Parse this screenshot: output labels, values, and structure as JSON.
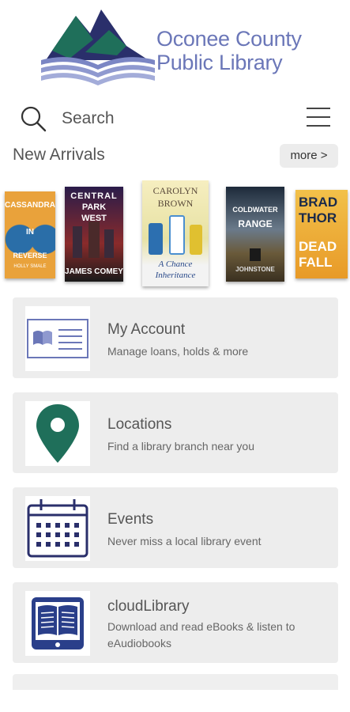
{
  "app": {
    "title": "Oconee County Public Library"
  },
  "header": {
    "logo_line1": "Oconee County",
    "logo_line2": "Public Library"
  },
  "search": {
    "label": "Search",
    "icon": "search-icon"
  },
  "menu": {
    "icon": "hamburger-menu-icon"
  },
  "new_arrivals": {
    "title": "New Arrivals",
    "more_label": "more >",
    "books": [
      {
        "title": "CASSANDRA IN REVERSE",
        "author": "HOLLY SMALE"
      },
      {
        "title": "CENTRAL PARK WEST",
        "author": "JAMES COMEY"
      },
      {
        "title": "A Chance Inheritance",
        "author": "CAROLYN BROWN"
      },
      {
        "title": "COLDWATER RANGE",
        "author": "JOHNSTONE"
      },
      {
        "title": "DEAD FALL",
        "author": "BRAD THOR"
      }
    ]
  },
  "cards": [
    {
      "title": "My Account",
      "subtitle": "Manage loans, holds & more",
      "icon": "account-book-icon"
    },
    {
      "title": "Locations",
      "subtitle": "Find a library branch near you",
      "icon": "map-pin-icon"
    },
    {
      "title": "Events",
      "subtitle": "Never miss a local library event",
      "icon": "calendar-icon"
    },
    {
      "title": "cloudLibrary",
      "subtitle": "Download and read eBooks & listen to eAudiobooks",
      "icon": "ebook-tablet-icon"
    }
  ],
  "colors": {
    "brand_purple": "#6b77b8",
    "brand_teal": "#1f6f5a",
    "brand_navy": "#2a2f6b",
    "card_bg": "#ededed"
  }
}
